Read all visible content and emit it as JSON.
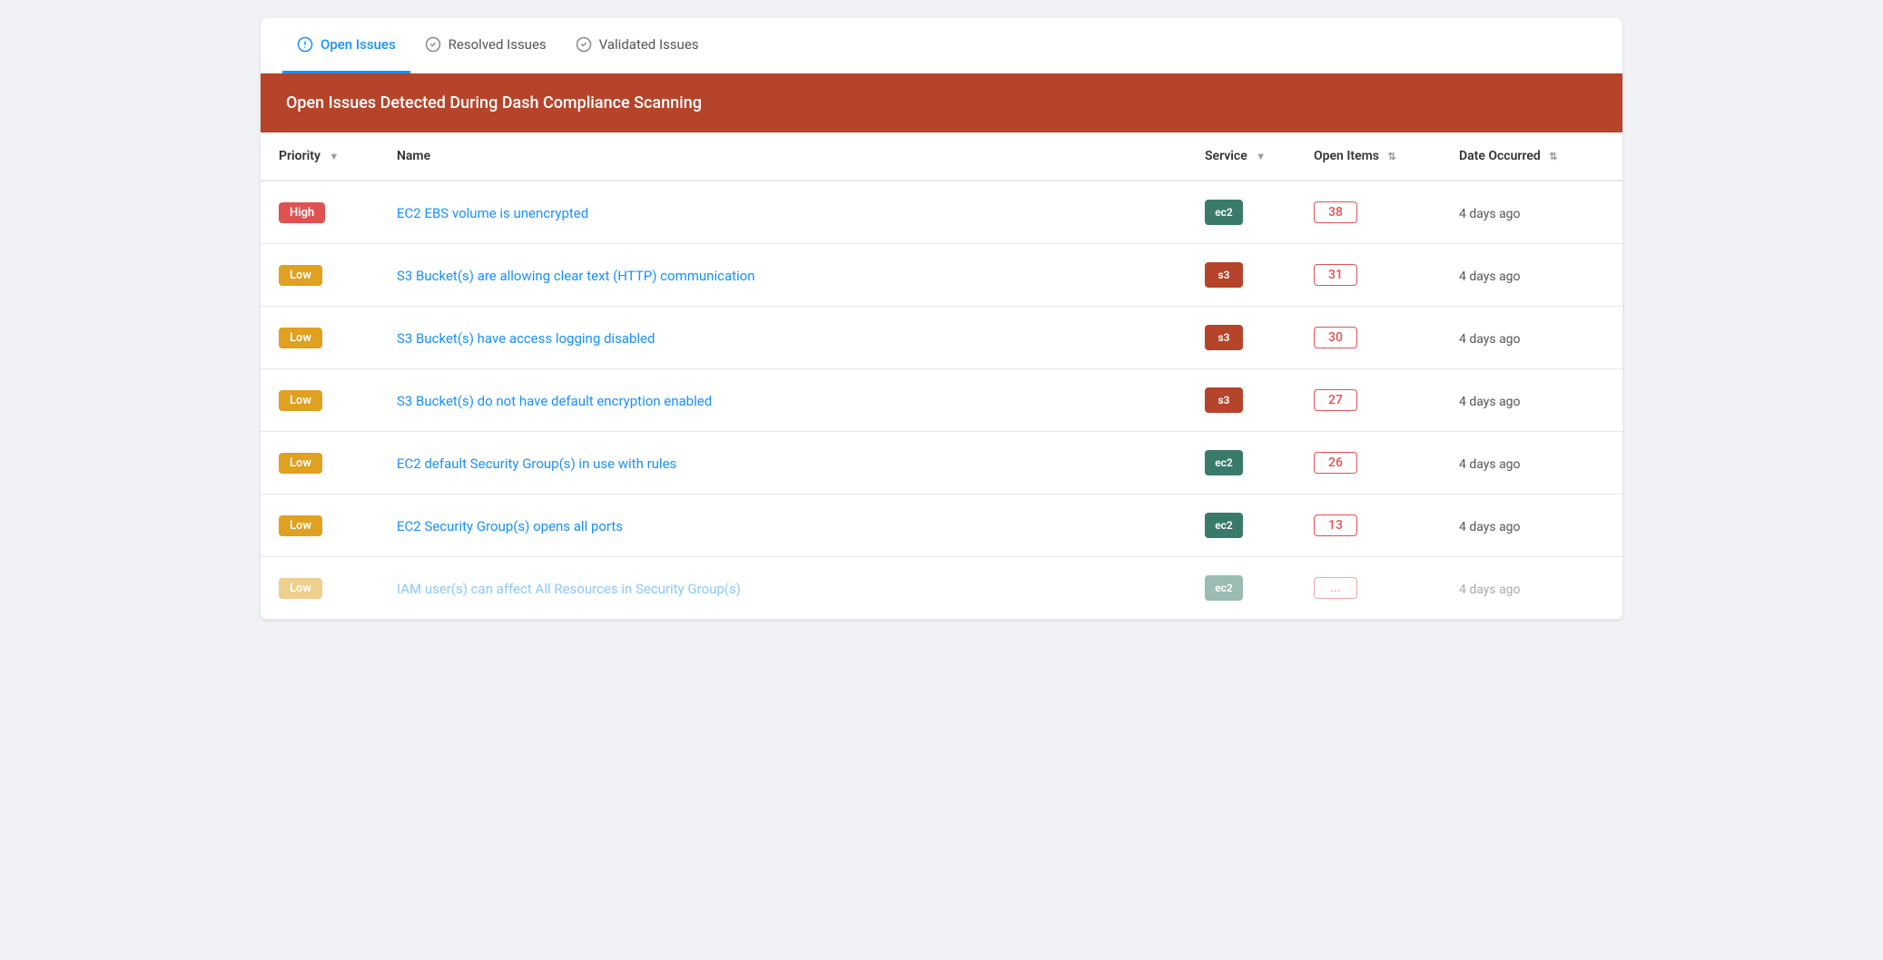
{
  "tabs": [
    {
      "id": "open",
      "label": "Open Issues",
      "active": true,
      "icon": "alert-circle"
    },
    {
      "id": "resolved",
      "label": "Resolved Issues",
      "active": false,
      "icon": "check-circle"
    },
    {
      "id": "validated",
      "label": "Validated Issues",
      "active": false,
      "icon": "check-circle"
    }
  ],
  "banner": {
    "text": "Open Issues Detected During Dash Compliance Scanning"
  },
  "table": {
    "columns": [
      {
        "id": "priority",
        "label": "Priority",
        "sortable": true
      },
      {
        "id": "name",
        "label": "Name",
        "sortable": false
      },
      {
        "id": "service",
        "label": "Service",
        "sortable": true
      },
      {
        "id": "open_items",
        "label": "Open Items",
        "sortable": true
      },
      {
        "id": "date_occurred",
        "label": "Date Occurred",
        "sortable": true
      }
    ],
    "rows": [
      {
        "priority": "High",
        "priority_class": "high",
        "name": "EC2 EBS volume is unencrypted",
        "service": "ec2",
        "service_class": "ec2",
        "open_items": "38",
        "date": "4 days ago",
        "partial": false
      },
      {
        "priority": "Low",
        "priority_class": "low",
        "name": "S3 Bucket(s) are allowing clear text (HTTP) communication",
        "service": "s3",
        "service_class": "s3",
        "open_items": "31",
        "date": "4 days ago",
        "partial": false
      },
      {
        "priority": "Low",
        "priority_class": "low",
        "name": "S3 Bucket(s) have access logging disabled",
        "service": "s3",
        "service_class": "s3",
        "open_items": "30",
        "date": "4 days ago",
        "partial": false
      },
      {
        "priority": "Low",
        "priority_class": "low",
        "name": "S3 Bucket(s) do not have default encryption enabled",
        "service": "s3",
        "service_class": "s3",
        "open_items": "27",
        "date": "4 days ago",
        "partial": false
      },
      {
        "priority": "Low",
        "priority_class": "low",
        "name": "EC2 default Security Group(s) in use with rules",
        "service": "ec2",
        "service_class": "ec2",
        "open_items": "26",
        "date": "4 days ago",
        "partial": false
      },
      {
        "priority": "Low",
        "priority_class": "low",
        "name": "EC2 Security Group(s) opens all ports",
        "service": "ec2",
        "service_class": "ec2",
        "open_items": "13",
        "date": "4 days ago",
        "partial": false
      },
      {
        "priority": "Low",
        "priority_class": "low",
        "name": "IAM user(s) can affect All Resources in Security Group(s)",
        "service": "ec2",
        "service_class": "ec2",
        "open_items": "...",
        "date": "4 days ago",
        "partial": true
      }
    ]
  }
}
